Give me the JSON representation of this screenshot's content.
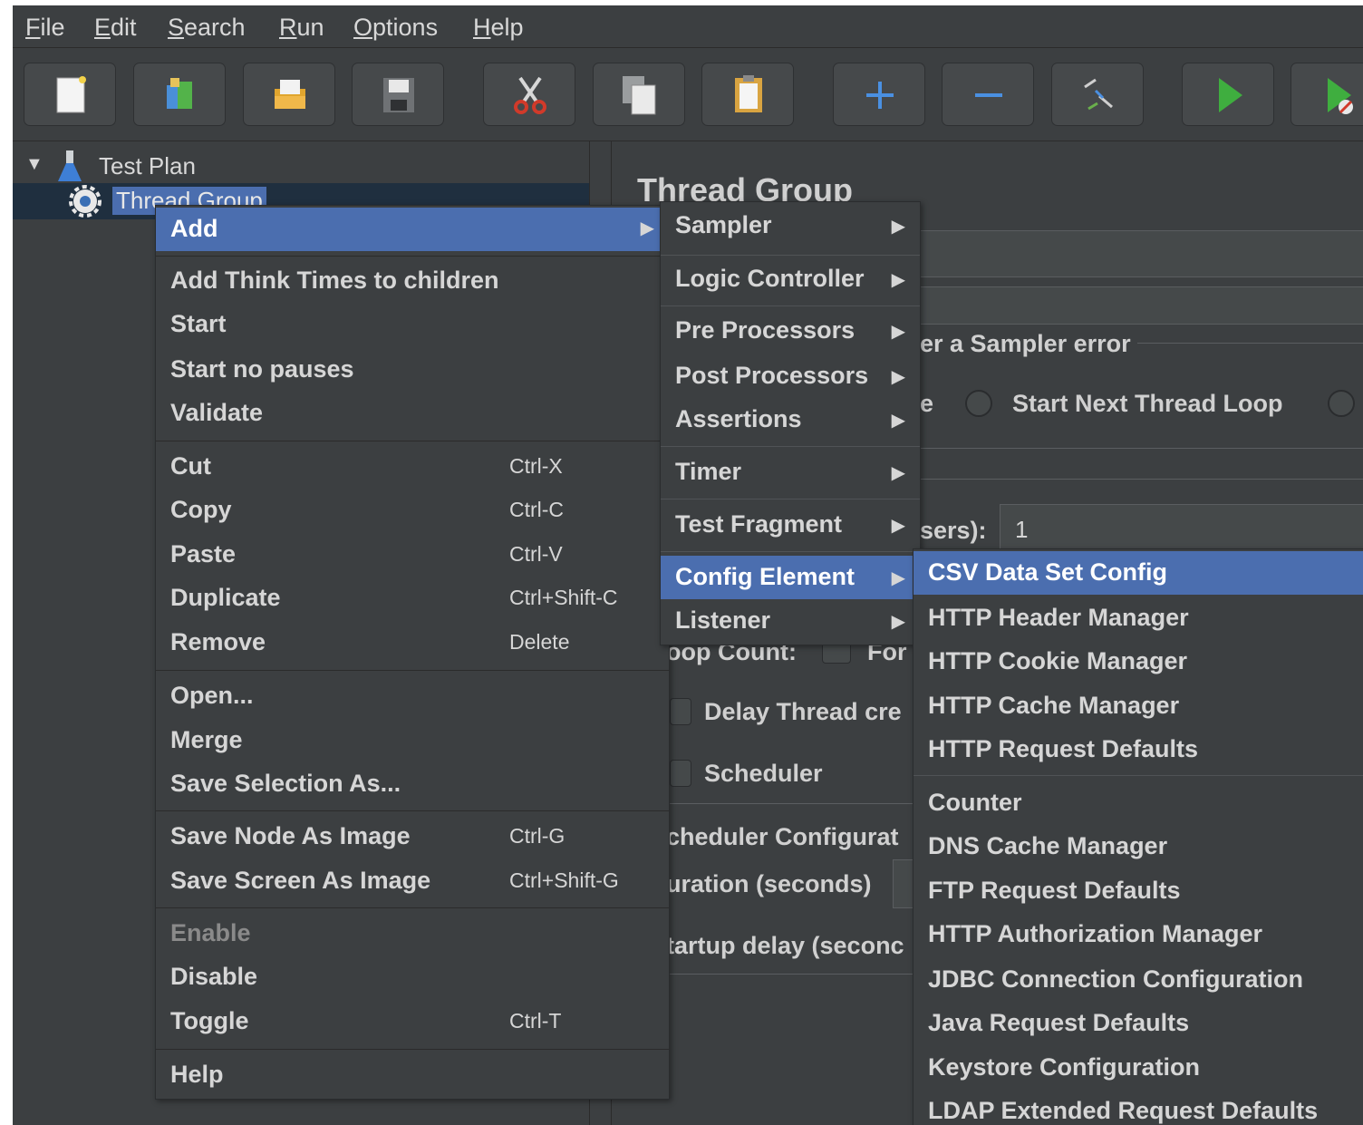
{
  "menubar": {
    "items": [
      {
        "underline": "F",
        "rest": "ile"
      },
      {
        "underline": "E",
        "rest": "dit"
      },
      {
        "underline": "S",
        "rest": "earch"
      },
      {
        "underline": "R",
        "rest": "un"
      },
      {
        "underline": "O",
        "rest": "ptions"
      },
      {
        "underline": "H",
        "rest": "elp"
      }
    ]
  },
  "toolbar": {
    "buttons": [
      "new-icon",
      "templates-icon",
      "open-icon",
      "save-icon",
      "cut-icon",
      "copy-icon",
      "paste-icon",
      "expand-icon",
      "collapse-icon",
      "toggle-icon",
      "start-icon",
      "start-no-pauses-icon"
    ]
  },
  "tree": {
    "test_plan": "Test Plan",
    "thread_group": "Thread Group"
  },
  "right_panel": {
    "title": "Thread Group",
    "sampler_error": "er a Sampler error",
    "action_partial": "e",
    "start_next_loop": "Start Next Thread Loop",
    "users_partial": "sers):",
    "users_value": "1",
    "loop_count_partial": "oop Count:",
    "forever_partial": "For",
    "delay_partial": "Delay Thread cre",
    "scheduler": "Scheduler",
    "scheduler_config_partial": "cheduler Configurat",
    "duration_partial": "uration (seconds)",
    "startup_delay_partial": "tartup delay (seconc"
  },
  "context_menu": {
    "add": "Add",
    "add_think_times": "Add Think Times to children",
    "start": "Start",
    "start_no_pauses": "Start no pauses",
    "validate": "Validate",
    "cut": "Cut",
    "cut_sc": "Ctrl-X",
    "copy": "Copy",
    "copy_sc": "Ctrl-C",
    "paste": "Paste",
    "paste_sc": "Ctrl-V",
    "duplicate": "Duplicate",
    "duplicate_sc": "Ctrl+Shift-C",
    "remove": "Remove",
    "remove_sc": "Delete",
    "open": "Open...",
    "merge": "Merge",
    "save_selection": "Save Selection As...",
    "save_node_image": "Save Node As Image",
    "save_node_image_sc": "Ctrl-G",
    "save_screen_image": "Save Screen As Image",
    "save_screen_image_sc": "Ctrl+Shift-G",
    "enable": "Enable",
    "disable": "Disable",
    "toggle": "Toggle",
    "toggle_sc": "Ctrl-T",
    "help": "Help"
  },
  "add_submenu": {
    "sampler": "Sampler",
    "logic_controller": "Logic Controller",
    "pre_processors": "Pre Processors",
    "post_processors": "Post Processors",
    "assertions": "Assertions",
    "timer": "Timer",
    "test_fragment": "Test Fragment",
    "config_element": "Config Element",
    "listener": "Listener"
  },
  "config_submenu": {
    "items": [
      "CSV Data Set Config",
      "HTTP Header Manager",
      "HTTP Cookie Manager",
      "HTTP Cache Manager",
      "HTTP Request Defaults",
      "Counter",
      "DNS Cache Manager",
      "FTP Request Defaults",
      "HTTP Authorization Manager",
      "JDBC Connection Configuration",
      "Java Request Defaults",
      "Keystore Configuration",
      "LDAP Extended Request Defaults"
    ]
  },
  "arrow_glyph": "▶",
  "expand_glyph": "▼"
}
